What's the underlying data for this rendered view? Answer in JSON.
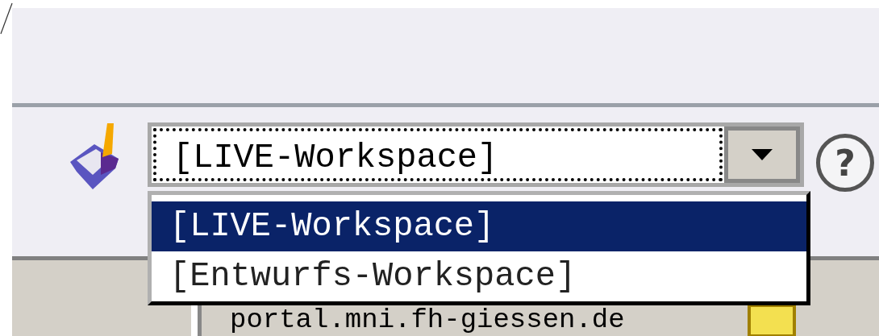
{
  "workspace_select": {
    "value": "[LIVE-Workspace]",
    "expanded": true,
    "options": [
      {
        "label": "[LIVE-Workspace]",
        "selected": true
      },
      {
        "label": "[Entwurfs-Workspace]",
        "selected": false
      }
    ]
  },
  "help_button": {
    "label": "?"
  },
  "tree_item": {
    "label": "portal.mni.fh-giessen.de"
  }
}
